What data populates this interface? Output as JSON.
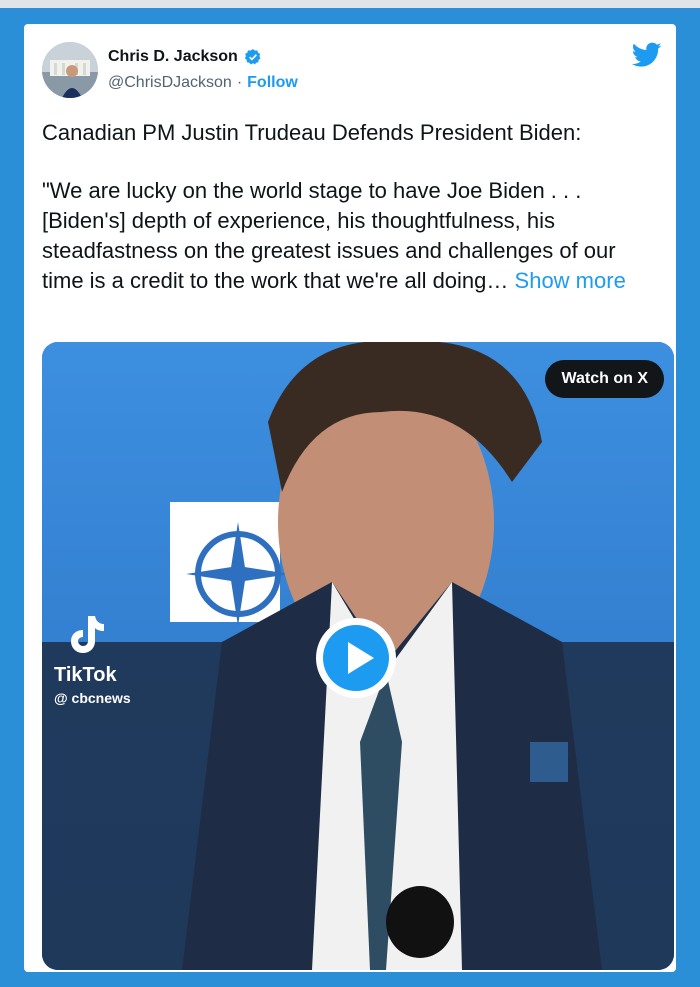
{
  "tweet": {
    "author_name": "Chris D. Jackson",
    "handle": "@ChrisDJackson",
    "separator": "·",
    "follow_label": "Follow",
    "text_line1": "Canadian PM Justin Trudeau Defends President Biden:",
    "text_quote": "\"We are lucky on the world stage to have Joe Biden . . . [Biden's] depth of experience, his thoughtfulness, his steadfastness on the greatest issues and challenges of our time is a credit to the work that we're all doing…",
    "show_more_label": "Show more"
  },
  "media": {
    "watch_label": "Watch on X",
    "tiktok_brand": "TikTok",
    "tiktok_handle": "@ cbcnews"
  },
  "icons": {
    "verified": "verified-badge-icon",
    "bird": "twitter-bird-icon",
    "play": "play-icon",
    "tiktok": "tiktok-logo-icon"
  },
  "colors": {
    "accent": "#1d9bf0",
    "frame_bg": "#2a8fd6",
    "video_bg": "#2f7fd6"
  }
}
